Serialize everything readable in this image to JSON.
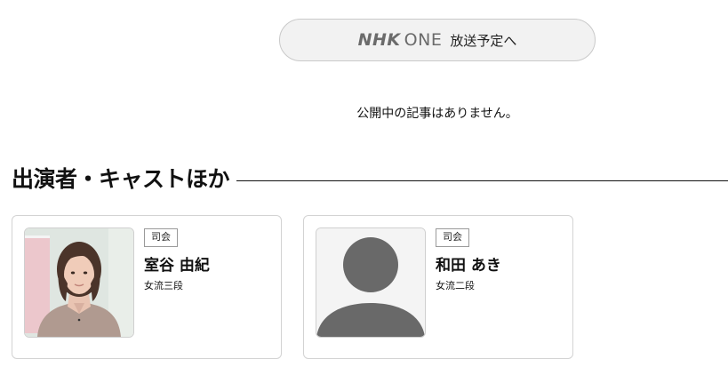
{
  "schedule": {
    "brand_nhk": "NHK",
    "brand_one": "ONE",
    "label": "放送予定へ"
  },
  "articles": {
    "empty_message": "公開中の記事はありません。"
  },
  "cast_section": {
    "title": "出演者・キャストほか",
    "members": [
      {
        "role": "司会",
        "name": "室谷 由紀",
        "rank": "女流三段",
        "photo": "portrait-photo"
      },
      {
        "role": "司会",
        "name": "和田 あき",
        "rank": "女流二段",
        "photo": "placeholder-avatar-icon"
      }
    ]
  }
}
